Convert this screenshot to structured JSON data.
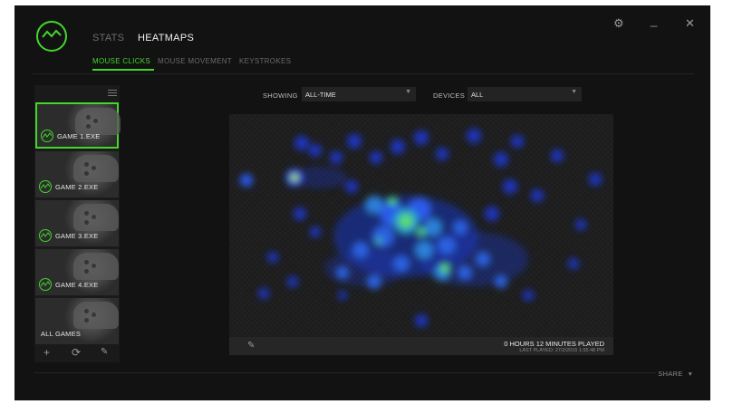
{
  "header": {
    "tabs": [
      {
        "label": "STATS",
        "active": false
      },
      {
        "label": "HEATMAPS",
        "active": true
      }
    ],
    "subtabs": [
      {
        "label": "MOUSE CLICKS",
        "active": true
      },
      {
        "label": "MOUSE MOVEMENT",
        "active": false
      },
      {
        "label": "KEYSTROKES",
        "active": false
      }
    ],
    "window_icons": [
      "gear-icon",
      "minimize-icon",
      "close-icon"
    ]
  },
  "sidebar": {
    "games": [
      {
        "label": "GAME 1.EXE",
        "selected": true
      },
      {
        "label": "GAME 2.EXE",
        "selected": false
      },
      {
        "label": "GAME 3.EXE",
        "selected": false
      },
      {
        "label": "GAME 4.EXE",
        "selected": false
      }
    ],
    "all_games_label": "ALL GAMES",
    "toolbar_icons": [
      "plus-icon",
      "refresh-icon",
      "pen-icon"
    ]
  },
  "filters": {
    "showing_label": "SHOWING",
    "showing_value": "ALL-TIME",
    "devices_label": "DEVICES",
    "devices_value": "ALL"
  },
  "heatmap": {
    "played_text": "0 HOURS 12 MINUTES PLAYED",
    "last_played_text": "LAST PLAYED: 27/2/2015 1:55:48 PM"
  },
  "footer": {
    "share_label": "SHARE"
  },
  "colors": {
    "accent": "#44d62c",
    "background": "#121212",
    "heat_low": "#1f3fd6",
    "heat_mid": "#2aa0c8",
    "heat_high": "#5fe05a"
  }
}
